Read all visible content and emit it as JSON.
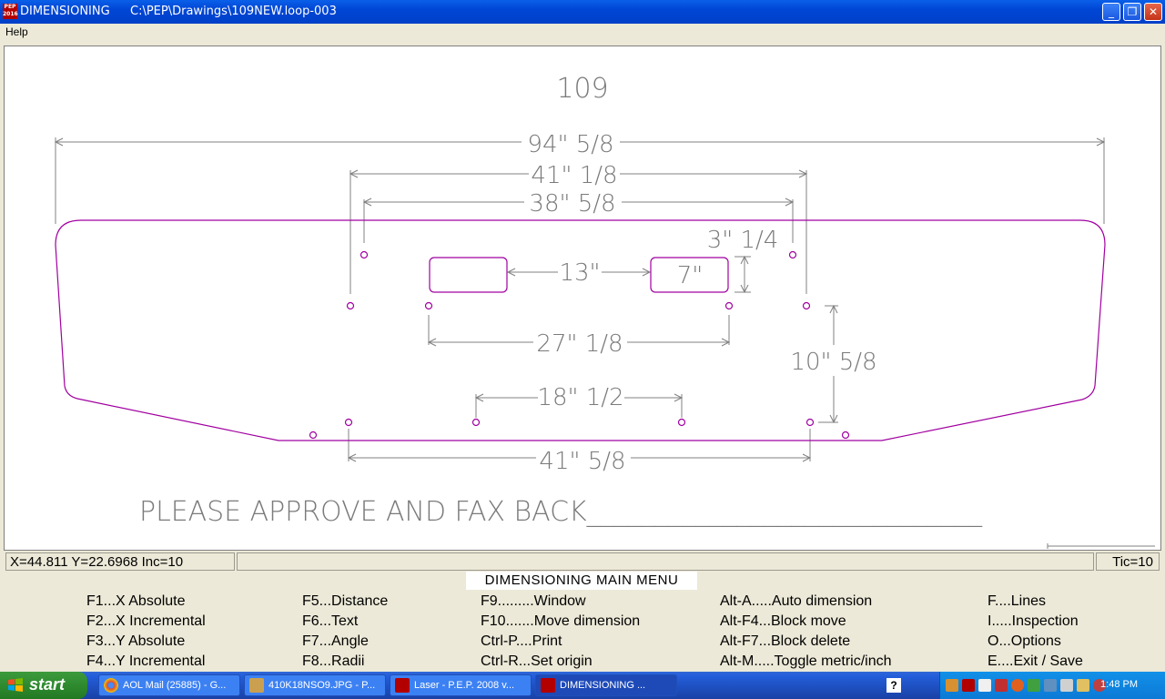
{
  "window": {
    "app_name": "DIMENSIONING",
    "file_path": "C:\\PEP\\Drawings\\109NEW.loop-003",
    "icon_text": "PEP 2016"
  },
  "menubar": {
    "help": "Help"
  },
  "drawing": {
    "title": "109",
    "dimensions": {
      "overall_width": "94\" 5/8",
      "outer_holes": "41\" 1/8",
      "upper_holes": "38\" 5/8",
      "upper_offset": "3\" 1/4",
      "slot_gap": "13\"",
      "slot_width": "7\"",
      "inner_holes": "27\" 1/8",
      "vertical_span": "10\" 5/8",
      "lower_inner_holes": "18\" 1/2",
      "lower_outer_holes": "41\" 5/8"
    },
    "note": "PLEASE APPROVE AND FAX BACK_____________________________",
    "line_color": "#a000a0",
    "dimension_color": "#808080"
  },
  "status": {
    "coords": "X=44.811  Y=22.6968  Inc=10",
    "tic": "Tic=10"
  },
  "main_menu": {
    "title": "DIMENSIONING MAIN MENU",
    "col1": [
      "F1...X Absolute",
      "F2...X Incremental",
      "F3...Y Absolute",
      "F4...Y Incremental"
    ],
    "col2": [
      "F5...Distance",
      "F6...Text",
      "F7...Angle",
      "F8...Radii"
    ],
    "col3": [
      "F9.........Window",
      "F10.......Move dimension",
      "Ctrl-P....Print",
      "Ctrl-R...Set origin"
    ],
    "col4": [
      "Alt-A.....Auto dimension",
      "Alt-F4...Block move",
      "Alt-F7...Block delete",
      "Alt-M.....Toggle metric/inch"
    ],
    "col5": [
      "F....Lines",
      "I.....Inspection",
      "O...Options",
      "E....Exit / Save"
    ]
  },
  "taskbar": {
    "start": "start",
    "tasks": [
      {
        "label": "AOL Mail (25885) - G...",
        "icon": "chrome-icon"
      },
      {
        "label": "410K18NSO9.JPG - P...",
        "icon": "image-viewer-icon"
      },
      {
        "label": "Laser - P.E.P. 2008 v...",
        "icon": "pep-icon"
      },
      {
        "label": "DIMENSIONING       ...",
        "icon": "pep-icon"
      }
    ],
    "clock": "1:48 PM"
  }
}
